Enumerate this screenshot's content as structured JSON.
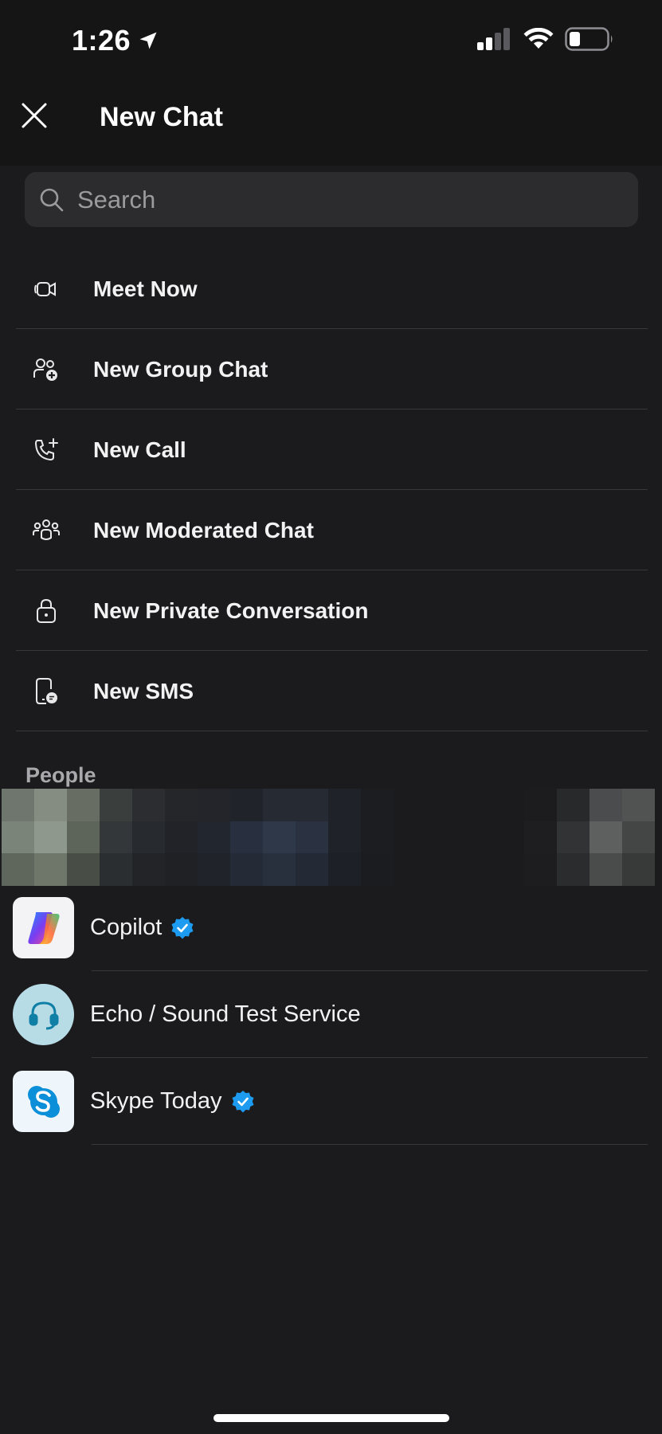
{
  "status_bar": {
    "time": "1:26",
    "cellular_icon": "cellular-signal-icon",
    "wifi_icon": "wifi-icon",
    "battery_icon": "battery-icon"
  },
  "header": {
    "title": "New Chat",
    "close_icon": "close-icon"
  },
  "search": {
    "placeholder": "Search",
    "value": "",
    "icon": "search-icon"
  },
  "actions": [
    {
      "label": "Meet Now",
      "icon": "video-camera-icon"
    },
    {
      "label": "New Group Chat",
      "icon": "group-add-icon"
    },
    {
      "label": "New Call",
      "icon": "phone-add-icon"
    },
    {
      "label": "New Moderated Chat",
      "icon": "people-team-icon"
    },
    {
      "label": "New Private Conversation",
      "icon": "lock-icon"
    },
    {
      "label": "New SMS",
      "icon": "phone-sms-icon"
    }
  ],
  "people": {
    "section_label": "People",
    "contacts": [
      {
        "name": "Copilot",
        "verified": true,
        "avatar": "copilot-logo"
      },
      {
        "name": "Echo / Sound Test Service",
        "verified": false,
        "avatar": "headset-avatar"
      },
      {
        "name": "Skype Today",
        "verified": true,
        "avatar": "skype-logo"
      }
    ]
  },
  "colors": {
    "background": "#1b1b1d",
    "header_background": "#151516",
    "search_background": "#2c2c2e",
    "verified_badge": "#1d9bf0",
    "divider": "#38383b"
  }
}
